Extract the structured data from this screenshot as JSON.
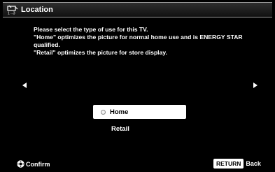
{
  "header": {
    "icon": "tv-setup-icon",
    "title": "Location"
  },
  "description": {
    "line1": "Please select the type of use for this TV.",
    "line2": " \"Home\" optimizes the picture for normal home use and is ENERGY STAR qualified.",
    "line3": "\"Retail\" optimizes the picture for store display."
  },
  "navigation": {
    "left_icon": "arrow-left-icon",
    "right_icon": "arrow-right-icon"
  },
  "options": [
    {
      "label": "Home",
      "selected": true
    },
    {
      "label": "Retail",
      "selected": false
    }
  ],
  "footer": {
    "confirm_icon": "dpad-icon",
    "confirm_label": "Confirm",
    "return_key": "RETURN",
    "back_label": "Back"
  },
  "colors": {
    "background": "#000000",
    "text": "#ffffff",
    "highlight": "#ffffff",
    "highlight_text": "#000000"
  }
}
